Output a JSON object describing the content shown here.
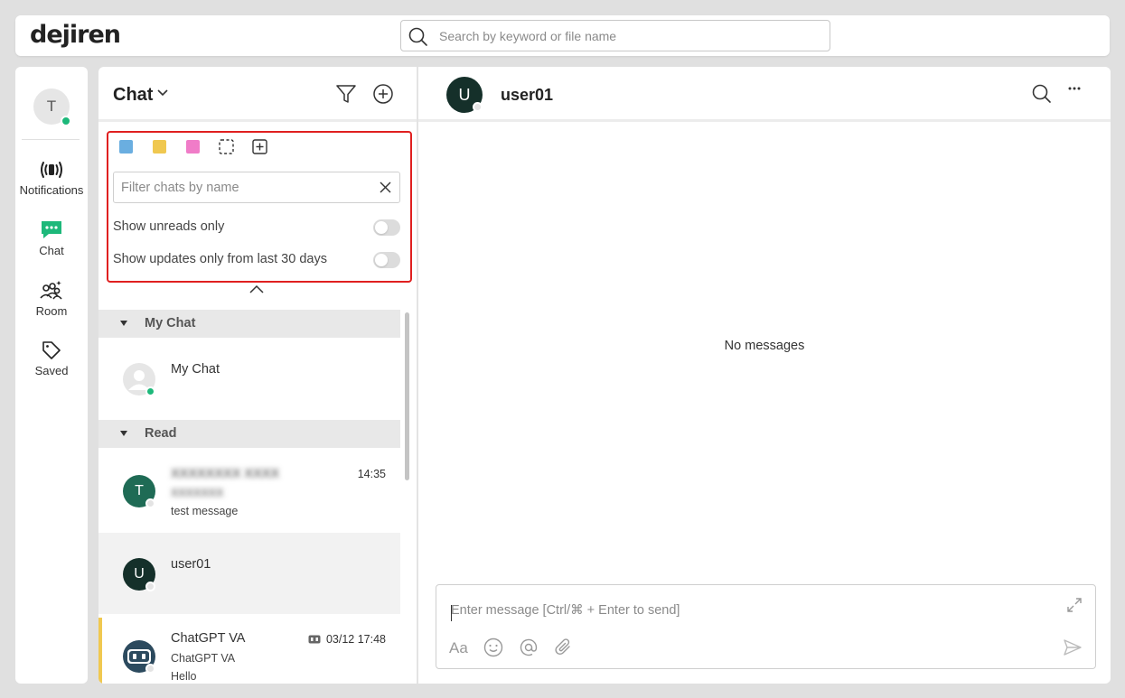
{
  "app": {
    "logo": "dejiren"
  },
  "search": {
    "placeholder": "Search by keyword or file name"
  },
  "nav": {
    "me_initial": "T",
    "items": [
      {
        "label": "Notifications",
        "icon": "notifications-icon"
      },
      {
        "label": "Chat",
        "icon": "chat-icon"
      },
      {
        "label": "Room",
        "icon": "room-icon"
      },
      {
        "label": "Saved",
        "icon": "tag-icon"
      }
    ]
  },
  "chat_list": {
    "title": "Chat",
    "filter_placeholder": "Filter chats by name",
    "colors": [
      "#6aaee0",
      "#f0c850",
      "#f07cc8"
    ],
    "toggle_unreads": {
      "label": "Show unreads only",
      "on": false
    },
    "toggle_recent": {
      "label": "Show updates only from last 30 days",
      "on": false
    },
    "sections": [
      {
        "label": "My Chat"
      },
      {
        "label": "Read"
      }
    ],
    "my_chat": {
      "name": "My Chat"
    },
    "rows": [
      {
        "initial": "T",
        "name": "(blurred)",
        "sub1": "(blurred)",
        "message": "test message",
        "time": "14:35",
        "avatar_color": "#1f6b55"
      },
      {
        "initial": "U",
        "name": "user01",
        "avatar_color": "#15302a",
        "selected": true
      },
      {
        "name": "ChatGPT VA",
        "sub1": "ChatGPT VA",
        "message": "Hello",
        "time": "03/12 17:48",
        "avatar_color": "#2c4a5e"
      }
    ]
  },
  "conversation": {
    "initial": "U",
    "name": "user01",
    "empty_text": "No messages",
    "composer_placeholder": "Enter message [Ctrl/⌘ + Enter to send]",
    "format_label": "Aa"
  }
}
